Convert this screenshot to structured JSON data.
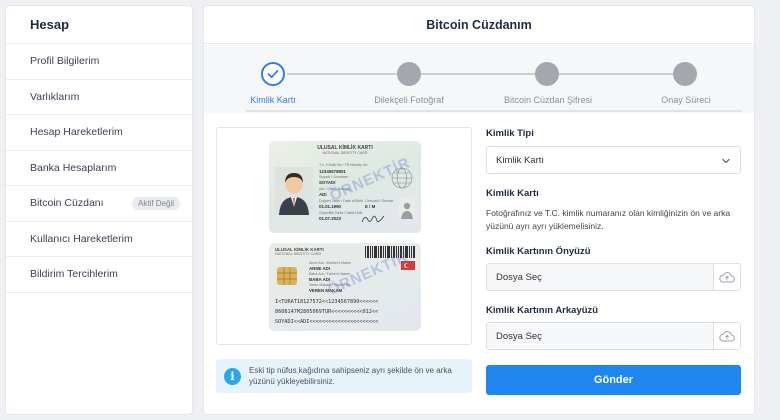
{
  "sidebar": {
    "title": "Hesap",
    "items": [
      {
        "label": "Profil Bilgilerim"
      },
      {
        "label": "Varlıklarım"
      },
      {
        "label": "Hesap Hareketlerim"
      },
      {
        "label": "Banka Hesaplarım"
      },
      {
        "label": "Bitcoin Cüzdanı",
        "badge": "Aktif Değil"
      },
      {
        "label": "Kullanıcı Hareketlerim"
      },
      {
        "label": "Bildirim Tercihlerim"
      }
    ]
  },
  "main": {
    "title": "Bitcoin Cüzdanım"
  },
  "stepper": {
    "accent_color": "#2f7fe6",
    "steps": [
      {
        "label": "Kimlik Kartı",
        "state": "done"
      },
      {
        "label": "Dilekçeli Fotoğraf",
        "state": "pending"
      },
      {
        "label": "Bitcoin Cüzdan Şifresi",
        "state": "pending"
      },
      {
        "label": "Onay Süreci",
        "state": "pending"
      }
    ]
  },
  "id_card": {
    "front_title": "ULUSAL KİMLİK KARTI",
    "front_subtitle": "NATIONAL IDENTITY CARD",
    "surname": "SOYADI",
    "gender": "E / M",
    "birth_date": "01.07.2023",
    "back_title": "ULUSAL KİMLİK KARTI",
    "back_subtitle": "NATIONAL IDENTITY CARD",
    "mother_name": "ANNE ADI",
    "father_name": "BABA ADI",
    "issuer": "VEREN MAKAM",
    "mrz_line1": "I<TURAT18127572<<1234567890<<<<<<",
    "mrz_line2": "8608147M2805069TUR<<<<<<<<<<012<<",
    "mrz_line3": "SOYADI<<ADI<<<<<<<<<<<<<<<<<<<<<<",
    "watermark": "ÖRNEKTİR"
  },
  "info": {
    "icon": "info-icon",
    "text": "Eski tip nüfus kağıdına sahipseniz ayrı şekilde ön ve arka yüzünü yükleyebilirsiniz."
  },
  "form": {
    "id_type_label": "Kimlik Tipi",
    "id_type_value": "Kimlik Kartı",
    "id_card_heading": "Kimlik Kartı",
    "id_card_help": "Fotoğrafınız ve T.C. kimlik numaranız olan kimliğinizin ön ve arka yüzünü ayrı ayrı yüklemelisiniz.",
    "front_label": "Kimlik Kartının Önyüzü",
    "front_file": "Dosya Seç",
    "back_label": "Kimlik Kartının Arkayüzü",
    "back_file": "Dosya Seç",
    "submit_label": "Gönder",
    "submit_color": "#1f86f0"
  }
}
